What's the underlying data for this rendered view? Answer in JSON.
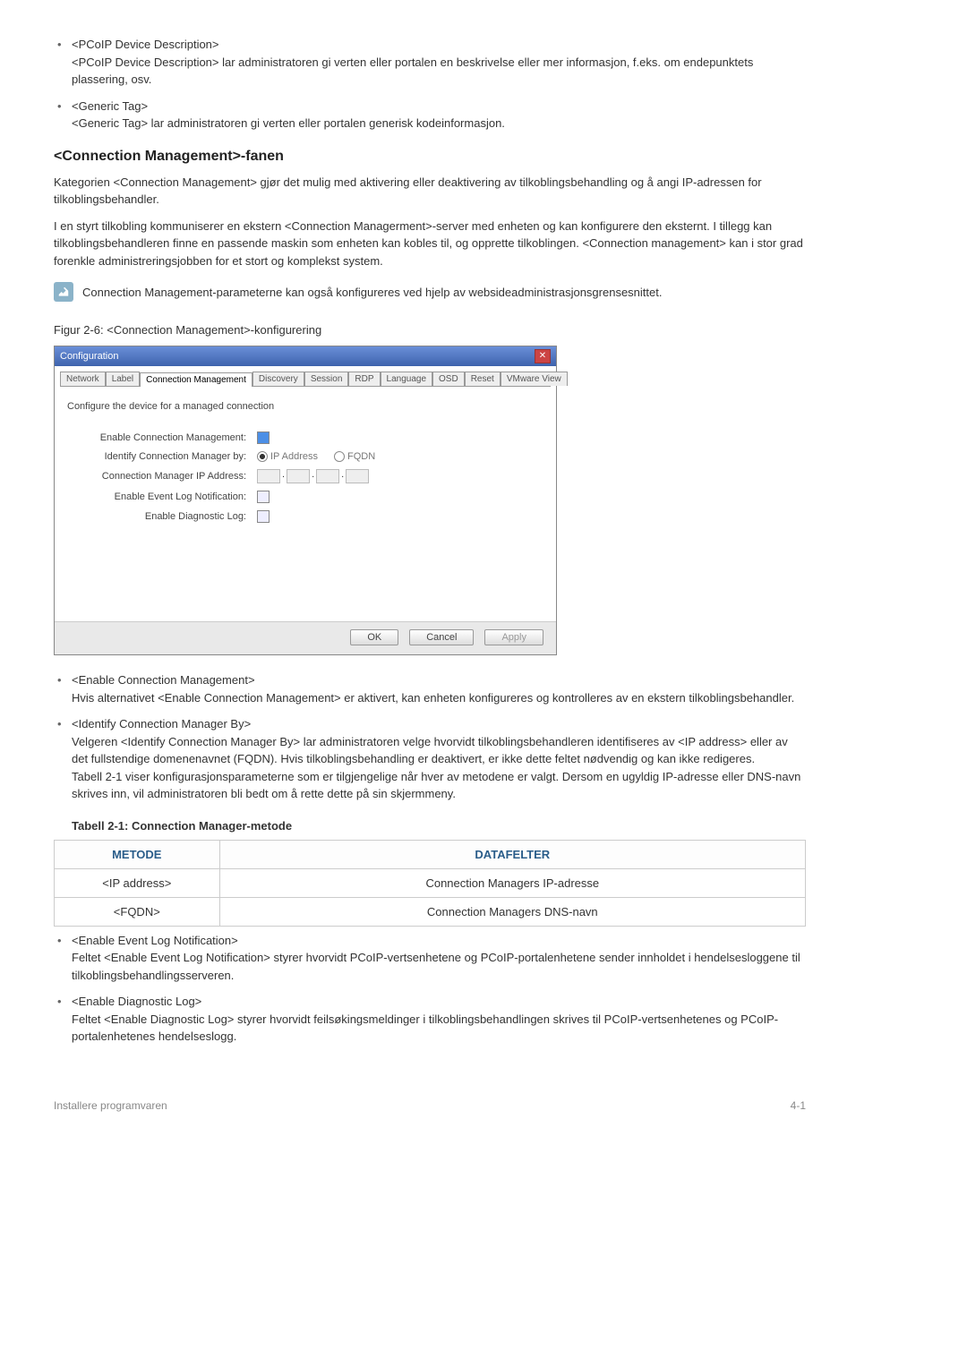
{
  "bullets_top": [
    {
      "term": "<PCoIP Device Description>",
      "desc": "<PCoIP Device Description> lar administratoren gi verten eller portalen en beskrivelse eller mer informasjon, f.eks. om endepunktets plassering, osv."
    },
    {
      "term": "<Generic Tag>",
      "desc": "<Generic Tag> lar administratoren gi verten eller portalen generisk kodeinformasjon."
    }
  ],
  "heading": "<Connection Management>-fanen",
  "para1": "Kategorien <Connection Management> gjør det mulig med aktivering eller deaktivering av tilkoblingsbehandling og å angi IP-adressen for tilkoblingsbehandler.",
  "para2": "I en styrt tilkobling kommuniserer en ekstern <Connection Managerment>-server med enheten og kan konfigurere den eksternt. I tillegg kan tilkoblingsbehandleren finne en passende maskin som enheten kan kobles til, og opprette tilkoblingen. <Connection management> kan i stor grad forenkle administreringsjobben for et stort og komplekst system.",
  "note": "Connection Management-parameterne kan også konfigureres ved hjelp av websideadministrasjonsgrensesnittet.",
  "figure_caption": "Figur 2-6: <Connection Management>-konfigurering",
  "dialog": {
    "title": "Configuration",
    "tabs": [
      "Network",
      "Label",
      "Connection Management",
      "Discovery",
      "Session",
      "RDP",
      "Language",
      "OSD",
      "Reset",
      "VMware View"
    ],
    "active_tab": "Connection Management",
    "intro": "Configure the device for a managed connection",
    "rows": {
      "enable_cm": "Enable Connection Management:",
      "identify_by": "Identify Connection Manager by:",
      "ip_label": "Connection Manager IP Address:",
      "event_log": "Enable Event Log Notification:",
      "diag_log": "Enable Diagnostic Log:"
    },
    "radio_ip": "IP Address",
    "radio_fqdn": "FQDN",
    "buttons": {
      "ok": "OK",
      "cancel": "Cancel",
      "apply": "Apply"
    }
  },
  "bullets_after": [
    {
      "term": "<Enable Connection Management>",
      "desc": "Hvis alternativet <Enable Connection Management> er aktivert, kan enheten konfigureres og kontrolleres av en ekstern tilkoblingsbehandler."
    },
    {
      "term": "<Identify Connection Manager By>",
      "desc": "Velgeren <Identify Connection Manager By> lar administratoren velge hvorvidt tilkoblingsbehandleren identifiseres av <IP address> eller av det fullstendige domenenavnet (FQDN). Hvis tilkoblingsbehandling er deaktivert, er ikke dette feltet nødvendig og kan ikke redigeres.",
      "desc2": "Tabell 2-1 viser konfigurasjonsparameterne som er tilgjengelige når hver av metodene er valgt. Dersom en ugyldig IP-adresse eller DNS-navn skrives inn, vil administratoren bli bedt om å rette dette på sin skjermmeny."
    }
  ],
  "table": {
    "caption": "Tabell 2-1: Connection Manager-metode",
    "headers": [
      "METODE",
      "DATAFELTER"
    ],
    "rows": [
      [
        "<IP address>",
        "Connection Managers IP-adresse"
      ],
      [
        "<FQDN>",
        "Connection Managers DNS-navn"
      ]
    ]
  },
  "bullets_last": [
    {
      "term": "<Enable Event Log Notification>",
      "desc": "Feltet <Enable Event Log Notification> styrer hvorvidt PCoIP-vertsenhetene og PCoIP-portalenhetene sender innholdet i hendelsesloggene til tilkoblingsbehandlingsserveren."
    },
    {
      "term": "<Enable Diagnostic Log>",
      "desc": "Feltet <Enable Diagnostic Log> styrer hvorvidt feilsøkingsmeldinger i tilkoblingsbehandlingen skrives til PCoIP-vertsenhetenes og PCoIP-portalenhetenes hendelseslogg."
    }
  ],
  "footer": {
    "left": "Installere programvaren",
    "right": "4-1"
  }
}
